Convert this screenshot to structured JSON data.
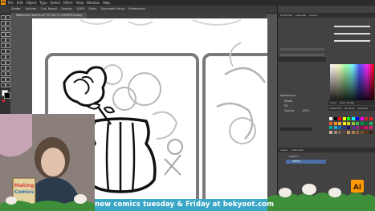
{
  "menubar": {
    "app_logo": "Ai",
    "items": [
      "File",
      "Edit",
      "Object",
      "Type",
      "Select",
      "Effect",
      "View",
      "Window",
      "Help"
    ]
  },
  "control_bar": {
    "items": [
      "Stroke:",
      "Uniform",
      "5 pt. Round",
      "Opacity:",
      "100%",
      "Style:",
      "Document Setup",
      "Preferences"
    ]
  },
  "document_tab": {
    "label": "Webcomic Sketch.ai* @ 200 % (CMYK/Preview)"
  },
  "panel": {
    "properties_tabs": [
      "Properties",
      "Libraries",
      "Layers"
    ],
    "appearance_label": "Appearance",
    "appearance_rows": [
      "Stroke",
      "Fill",
      "Opacity"
    ],
    "opacity_value": "100%",
    "swatches_tabs": [
      "Swatches",
      "Brushes",
      "Symbols"
    ],
    "layers_tabs": [
      "Layers",
      "Artboards"
    ],
    "layer_rows": [
      "Layer 1",
      "sketch"
    ],
    "color_tabs": [
      "Color",
      "Color Guide"
    ]
  },
  "colors": {
    "accent": "#ff9a00",
    "banner_bg": "#3aa7c6",
    "panel_bg": "#424242",
    "workspace_bg": "#535353"
  },
  "webcam": {
    "book_title_line1": "Making",
    "book_title_line2": "Comics"
  },
  "banner": {
    "text": "new comics tuesday & Friday at bekyoot.com"
  }
}
